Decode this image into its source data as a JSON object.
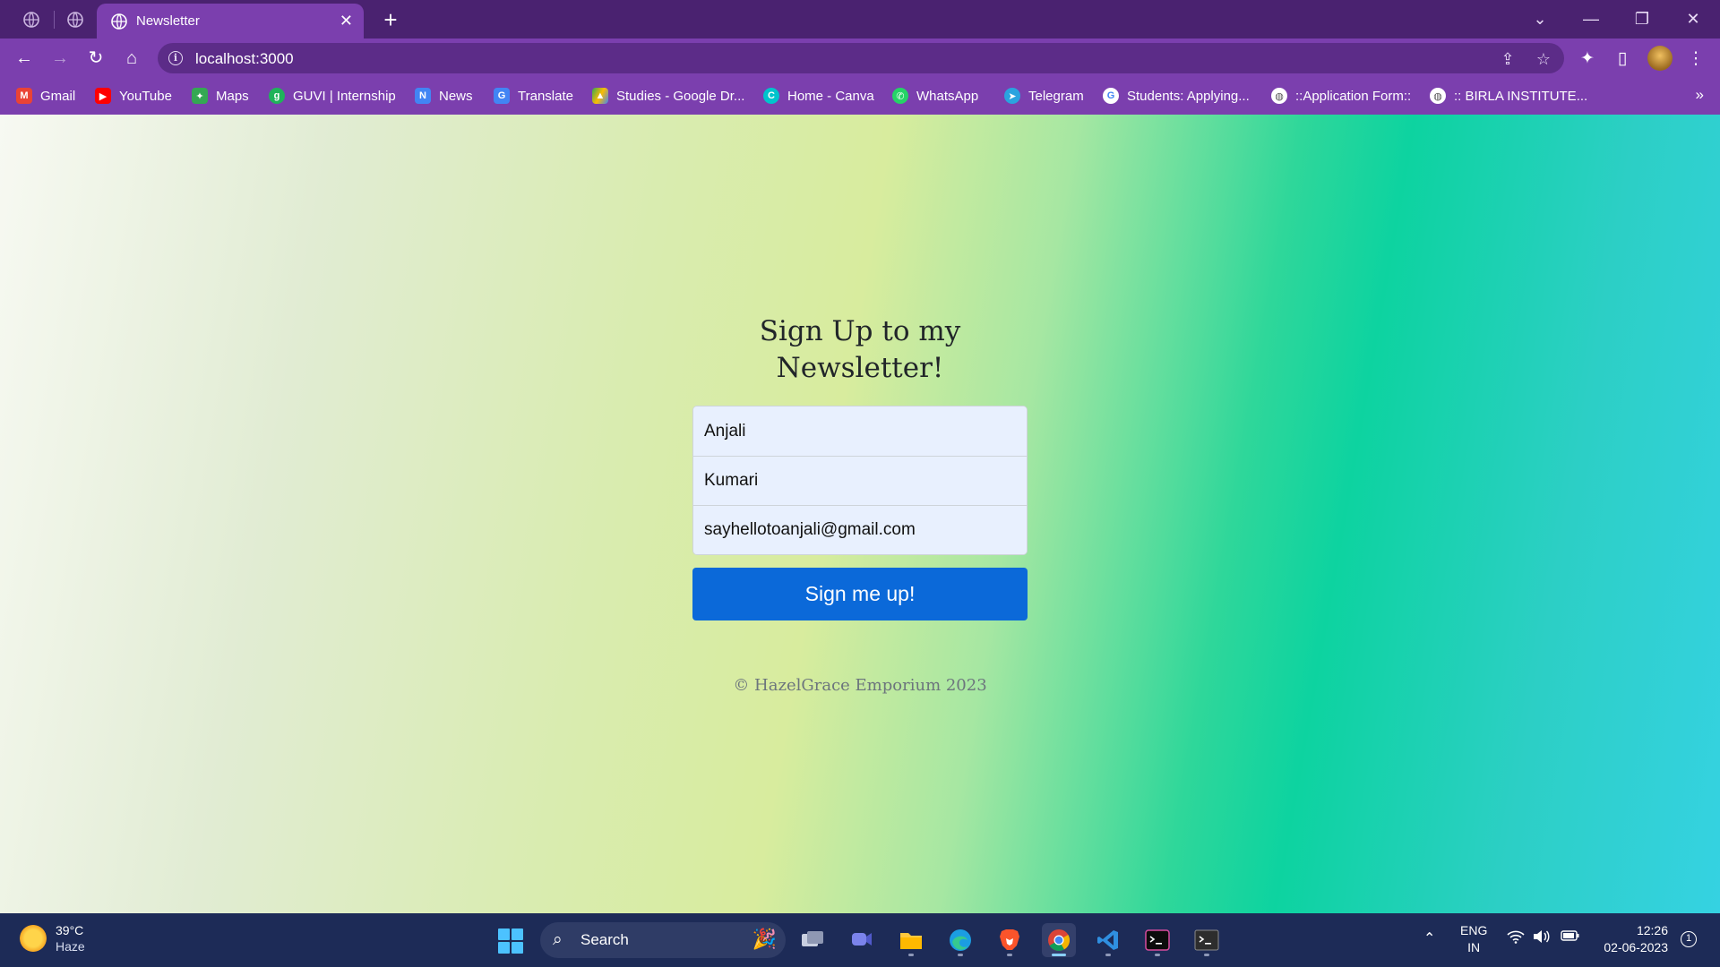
{
  "browser": {
    "tab": {
      "title": "Newsletter"
    },
    "address": {
      "url": "localhost:3000"
    },
    "bookmarks": [
      {
        "label": "Gmail",
        "icon": "gmail-icon",
        "color": "#ea4335"
      },
      {
        "label": "YouTube",
        "icon": "youtube-icon",
        "color": "#ff0000"
      },
      {
        "label": "Maps",
        "icon": "maps-icon",
        "color": "#34a853"
      },
      {
        "label": "GUVI | Internship",
        "icon": "guvi-icon",
        "color": "#1fb35a"
      },
      {
        "label": "News",
        "icon": "news-icon",
        "color": "#4285f4"
      },
      {
        "label": "Translate",
        "icon": "translate-icon",
        "color": "#4285f4"
      },
      {
        "label": "Studies - Google Dr...",
        "icon": "google-drive-icon",
        "color": "#fbbc04"
      },
      {
        "label": "Home - Canva",
        "icon": "canva-icon",
        "color": "#00c4cc"
      },
      {
        "label": "WhatsApp",
        "icon": "whatsapp-icon",
        "color": "#25d366"
      },
      {
        "label": "Telegram",
        "icon": "telegram-icon",
        "color": "#2aa3df"
      },
      {
        "label": "Students: Applying...",
        "icon": "google-icon",
        "color": "#ffffff"
      },
      {
        "label": "::Application Form::",
        "icon": "globe-icon",
        "color": "#ffffff"
      },
      {
        "label": ":: BIRLA INSTITUTE...",
        "icon": "globe-icon",
        "color": "#ffffff"
      }
    ]
  },
  "page": {
    "heading": "Sign Up to my Newsletter!",
    "form": {
      "first_name": "Anjali",
      "last_name": "Kumari",
      "email": "sayhellotoanjali@gmail.com",
      "submit_label": "Sign me up!"
    },
    "footer": "© HazelGrace Emporium 2023",
    "accent_color": "#0b69d9"
  },
  "taskbar": {
    "weather": {
      "temp": "39°C",
      "condition": "Haze"
    },
    "search_label": "Search",
    "language": {
      "line1": "ENG",
      "line2": "IN"
    },
    "time": "12:26",
    "date": "02-06-2023",
    "notification_count": "1"
  }
}
